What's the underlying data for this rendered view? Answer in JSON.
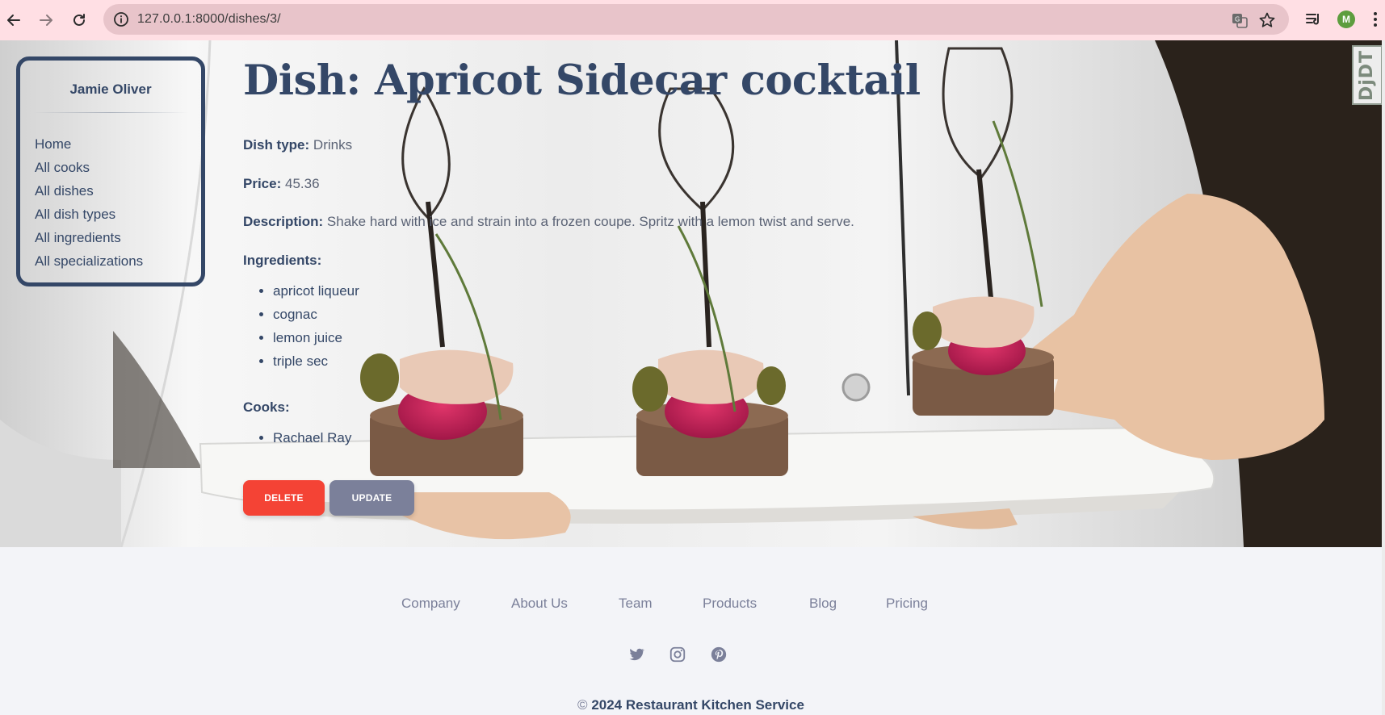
{
  "browser": {
    "url": "127.0.0.1:8000/dishes/3/",
    "profile_initial": "M"
  },
  "sidebar": {
    "brand": "Jamie Oliver",
    "items": [
      {
        "label": "Home"
      },
      {
        "label": "All cooks"
      },
      {
        "label": "All dishes"
      },
      {
        "label": "All dish types"
      },
      {
        "label": "All ingredients"
      },
      {
        "label": "All specializations"
      }
    ]
  },
  "dish": {
    "title": "Dish: Apricot Sidecar cocktail",
    "type_label": "Dish type:",
    "type_value": "Drinks",
    "price_label": "Price:",
    "price_value": "45.36",
    "description_label": "Description:",
    "description_value": "Shake hard with ice and strain into a frozen coupe. Spritz with a lemon twist and serve.",
    "ingredients_label": "Ingredients:",
    "ingredients": [
      "apricot liqueur",
      "cognac",
      "lemon juice",
      "triple sec"
    ],
    "cooks_label": "Cooks:",
    "cooks": [
      "Rachael Ray"
    ]
  },
  "actions": {
    "delete_label": "DELETE",
    "update_label": "UPDATE"
  },
  "debug_toolbar": {
    "label": "DjDT"
  },
  "footer": {
    "links": [
      "Company",
      "About Us",
      "Team",
      "Products",
      "Blog",
      "Pricing"
    ],
    "social_icons": [
      "twitter-icon",
      "instagram-icon",
      "pinterest-icon"
    ],
    "copyright_symbol": "©",
    "copyright_text": "2024 Restaurant Kitchen Service"
  },
  "colors": {
    "primary_text": "#344767",
    "delete": "#f44335",
    "update": "#7b809a",
    "chrome": "#ffdfe4"
  }
}
